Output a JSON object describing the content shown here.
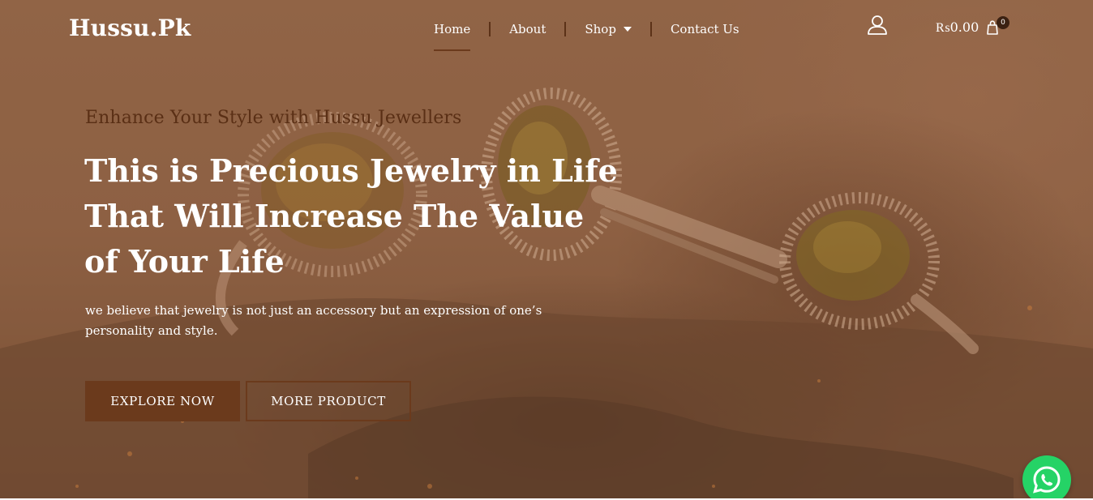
{
  "header": {
    "logo": "Hussu.Pk",
    "nav": [
      {
        "label": "Home",
        "active": true
      },
      {
        "label": "About",
        "active": false
      },
      {
        "label": "Shop",
        "has_dropdown": true
      },
      {
        "label": "Contact Us",
        "active": false
      }
    ],
    "user_icon": "user-icon",
    "cart": {
      "amount": "₨0.00",
      "count": "0",
      "icon": "shopping-bag-icon"
    }
  },
  "hero": {
    "subtitle": "Enhance Your Style with Hussu Jewellers",
    "headline": "This is Precious Jewelry in Life That Will Increase The Value of Your Life",
    "description": "we believe that jewelry is not just an accessory but an expression of one’s personality and style.",
    "buttons": {
      "explore": "EXPLORE NOW",
      "more": "MORE PRODUCT"
    },
    "background_description_icon": "rings-photo"
  },
  "floating": {
    "whatsapp_icon": "whatsapp-icon"
  },
  "colors": {
    "accent": "#6b3a1c",
    "subtitle": "#5a2f15",
    "overlay": "#8f6447",
    "whatsapp": "#25d366"
  }
}
